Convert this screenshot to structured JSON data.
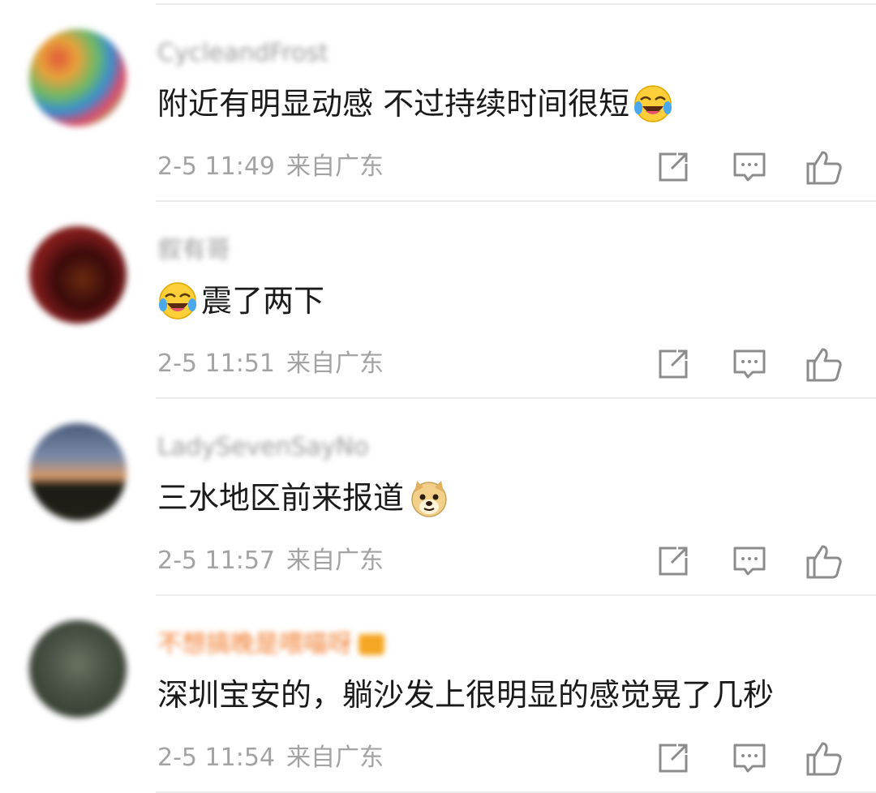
{
  "comments": [
    {
      "username": "CycleandFrost",
      "vip": false,
      "text_before": "",
      "text": "附近有明显动感 不过持续时间很短",
      "emoji": "laughing-crying-emoji",
      "emoji_position": "end",
      "time": "2-5 11:49",
      "location": "来自广东"
    },
    {
      "username": "叙有哥",
      "vip": false,
      "text": "震了两下",
      "emoji": "laughing-crying-emoji",
      "emoji_position": "start",
      "time": "2-5 11:51",
      "location": "来自广东"
    },
    {
      "username": "LadySevenSayNo",
      "vip": false,
      "text": "三水地区前来报道",
      "emoji": "doge-emoji",
      "emoji_position": "end",
      "time": "2-5 11:57",
      "location": "来自广东"
    },
    {
      "username": "不想搞晚是喂喵呀",
      "vip": true,
      "text": "深圳宝安的，躺沙发上很明显的感觉晃了几秒",
      "emoji": "",
      "emoji_position": "none",
      "time": "2-5 11:54",
      "location": "来自广东"
    }
  ],
  "icons": {
    "share": "share-icon",
    "reply": "comment-icon",
    "like": "thumbs-up-icon"
  },
  "colors": {
    "text": "#1a1a1a",
    "meta": "#a3a3a3",
    "username": "#9b9b9b",
    "vip_username": "#f07a2a",
    "icon": "#8c8c8c",
    "divider": "#ececec"
  }
}
